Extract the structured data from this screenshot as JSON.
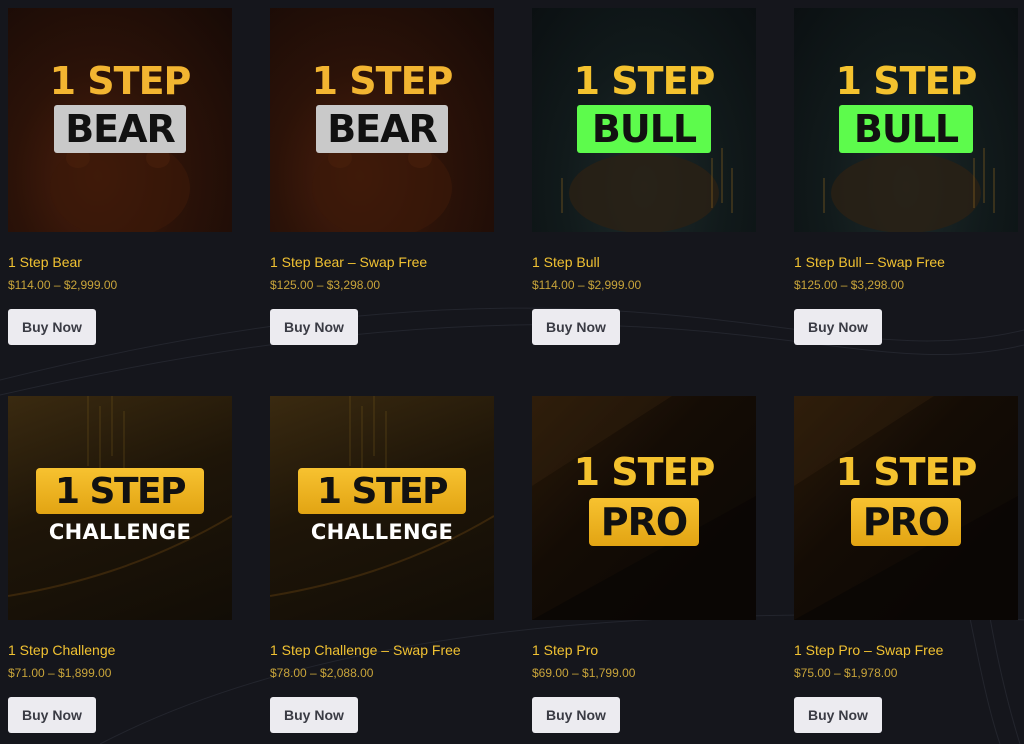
{
  "products": [
    {
      "name": "1 Step Bear",
      "price": "$114.00 – $2,999.00",
      "button": "Buy Now",
      "image": {
        "kind": "bear",
        "line1": "1 STEP",
        "line2": "BEAR"
      }
    },
    {
      "name": "1 Step Bear – Swap Free",
      "price": "$125.00 – $3,298.00",
      "button": "Buy Now",
      "image": {
        "kind": "bear",
        "line1": "1 STEP",
        "line2": "BEAR"
      }
    },
    {
      "name": "1 Step Bull",
      "price": "$114.00 – $2,999.00",
      "button": "Buy Now",
      "image": {
        "kind": "bull",
        "line1": "1 STEP",
        "line2": "BULL"
      }
    },
    {
      "name": "1 Step Bull – Swap Free",
      "price": "$125.00 – $3,298.00",
      "button": "Buy Now",
      "image": {
        "kind": "bull",
        "line1": "1 STEP",
        "line2": "BULL"
      }
    },
    {
      "name": "1 Step Challenge",
      "price": "$71.00 – $1,899.00",
      "button": "Buy Now",
      "image": {
        "kind": "challenge",
        "line1": "1 STEP",
        "line2": "CHALLENGE"
      }
    },
    {
      "name": "1 Step Challenge – Swap Free",
      "price": "$78.00 – $2,088.00",
      "button": "Buy Now",
      "image": {
        "kind": "challenge",
        "line1": "1 STEP",
        "line2": "CHALLENGE"
      }
    },
    {
      "name": "1 Step Pro",
      "price": "$69.00 – $1,799.00",
      "button": "Buy Now",
      "image": {
        "kind": "pro",
        "line1": "1 STEP",
        "line2": "PRO"
      }
    },
    {
      "name": "1 Step Pro – Swap Free",
      "price": "$75.00 – $1,978.00",
      "button": "Buy Now",
      "image": {
        "kind": "pro",
        "line1": "1 STEP",
        "line2": "PRO"
      }
    }
  ],
  "colors": {
    "background": "#15161c",
    "product_name": "#f1c232",
    "price": "#c8a43a",
    "button_bg": "#ecebf0",
    "button_text": "#3a3b44"
  }
}
